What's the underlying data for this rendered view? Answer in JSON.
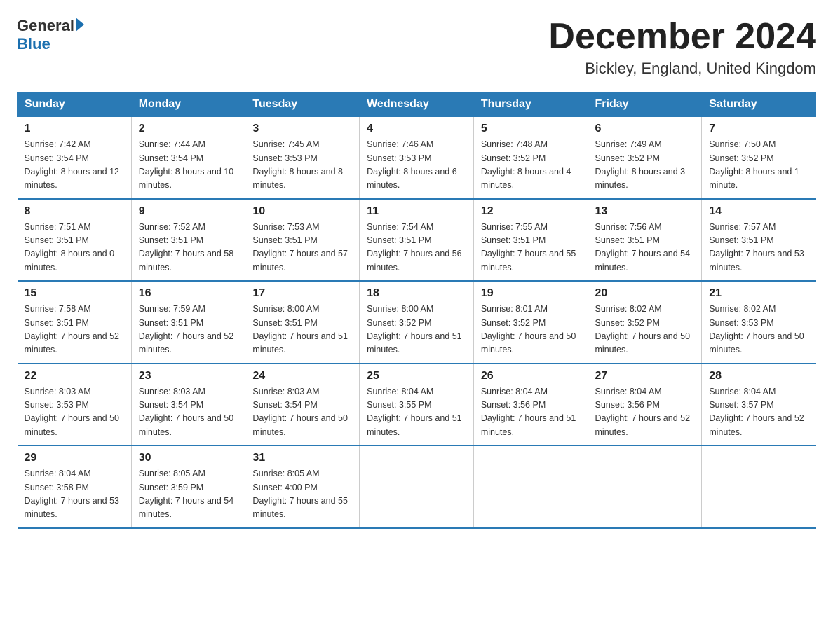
{
  "logo": {
    "general": "General",
    "blue": "Blue",
    "line2": "Blue"
  },
  "header": {
    "month_title": "December 2024",
    "location": "Bickley, England, United Kingdom"
  },
  "days_of_week": [
    "Sunday",
    "Monday",
    "Tuesday",
    "Wednesday",
    "Thursday",
    "Friday",
    "Saturday"
  ],
  "weeks": [
    [
      {
        "day": "1",
        "sunrise": "7:42 AM",
        "sunset": "3:54 PM",
        "daylight": "8 hours and 12 minutes."
      },
      {
        "day": "2",
        "sunrise": "7:44 AM",
        "sunset": "3:54 PM",
        "daylight": "8 hours and 10 minutes."
      },
      {
        "day": "3",
        "sunrise": "7:45 AM",
        "sunset": "3:53 PM",
        "daylight": "8 hours and 8 minutes."
      },
      {
        "day": "4",
        "sunrise": "7:46 AM",
        "sunset": "3:53 PM",
        "daylight": "8 hours and 6 minutes."
      },
      {
        "day": "5",
        "sunrise": "7:48 AM",
        "sunset": "3:52 PM",
        "daylight": "8 hours and 4 minutes."
      },
      {
        "day": "6",
        "sunrise": "7:49 AM",
        "sunset": "3:52 PM",
        "daylight": "8 hours and 3 minutes."
      },
      {
        "day": "7",
        "sunrise": "7:50 AM",
        "sunset": "3:52 PM",
        "daylight": "8 hours and 1 minute."
      }
    ],
    [
      {
        "day": "8",
        "sunrise": "7:51 AM",
        "sunset": "3:51 PM",
        "daylight": "8 hours and 0 minutes."
      },
      {
        "day": "9",
        "sunrise": "7:52 AM",
        "sunset": "3:51 PM",
        "daylight": "7 hours and 58 minutes."
      },
      {
        "day": "10",
        "sunrise": "7:53 AM",
        "sunset": "3:51 PM",
        "daylight": "7 hours and 57 minutes."
      },
      {
        "day": "11",
        "sunrise": "7:54 AM",
        "sunset": "3:51 PM",
        "daylight": "7 hours and 56 minutes."
      },
      {
        "day": "12",
        "sunrise": "7:55 AM",
        "sunset": "3:51 PM",
        "daylight": "7 hours and 55 minutes."
      },
      {
        "day": "13",
        "sunrise": "7:56 AM",
        "sunset": "3:51 PM",
        "daylight": "7 hours and 54 minutes."
      },
      {
        "day": "14",
        "sunrise": "7:57 AM",
        "sunset": "3:51 PM",
        "daylight": "7 hours and 53 minutes."
      }
    ],
    [
      {
        "day": "15",
        "sunrise": "7:58 AM",
        "sunset": "3:51 PM",
        "daylight": "7 hours and 52 minutes."
      },
      {
        "day": "16",
        "sunrise": "7:59 AM",
        "sunset": "3:51 PM",
        "daylight": "7 hours and 52 minutes."
      },
      {
        "day": "17",
        "sunrise": "8:00 AM",
        "sunset": "3:51 PM",
        "daylight": "7 hours and 51 minutes."
      },
      {
        "day": "18",
        "sunrise": "8:00 AM",
        "sunset": "3:52 PM",
        "daylight": "7 hours and 51 minutes."
      },
      {
        "day": "19",
        "sunrise": "8:01 AM",
        "sunset": "3:52 PM",
        "daylight": "7 hours and 50 minutes."
      },
      {
        "day": "20",
        "sunrise": "8:02 AM",
        "sunset": "3:52 PM",
        "daylight": "7 hours and 50 minutes."
      },
      {
        "day": "21",
        "sunrise": "8:02 AM",
        "sunset": "3:53 PM",
        "daylight": "7 hours and 50 minutes."
      }
    ],
    [
      {
        "day": "22",
        "sunrise": "8:03 AM",
        "sunset": "3:53 PM",
        "daylight": "7 hours and 50 minutes."
      },
      {
        "day": "23",
        "sunrise": "8:03 AM",
        "sunset": "3:54 PM",
        "daylight": "7 hours and 50 minutes."
      },
      {
        "day": "24",
        "sunrise": "8:03 AM",
        "sunset": "3:54 PM",
        "daylight": "7 hours and 50 minutes."
      },
      {
        "day": "25",
        "sunrise": "8:04 AM",
        "sunset": "3:55 PM",
        "daylight": "7 hours and 51 minutes."
      },
      {
        "day": "26",
        "sunrise": "8:04 AM",
        "sunset": "3:56 PM",
        "daylight": "7 hours and 51 minutes."
      },
      {
        "day": "27",
        "sunrise": "8:04 AM",
        "sunset": "3:56 PM",
        "daylight": "7 hours and 52 minutes."
      },
      {
        "day": "28",
        "sunrise": "8:04 AM",
        "sunset": "3:57 PM",
        "daylight": "7 hours and 52 minutes."
      }
    ],
    [
      {
        "day": "29",
        "sunrise": "8:04 AM",
        "sunset": "3:58 PM",
        "daylight": "7 hours and 53 minutes."
      },
      {
        "day": "30",
        "sunrise": "8:05 AM",
        "sunset": "3:59 PM",
        "daylight": "7 hours and 54 minutes."
      },
      {
        "day": "31",
        "sunrise": "8:05 AM",
        "sunset": "4:00 PM",
        "daylight": "7 hours and 55 minutes."
      },
      null,
      null,
      null,
      null
    ]
  ]
}
